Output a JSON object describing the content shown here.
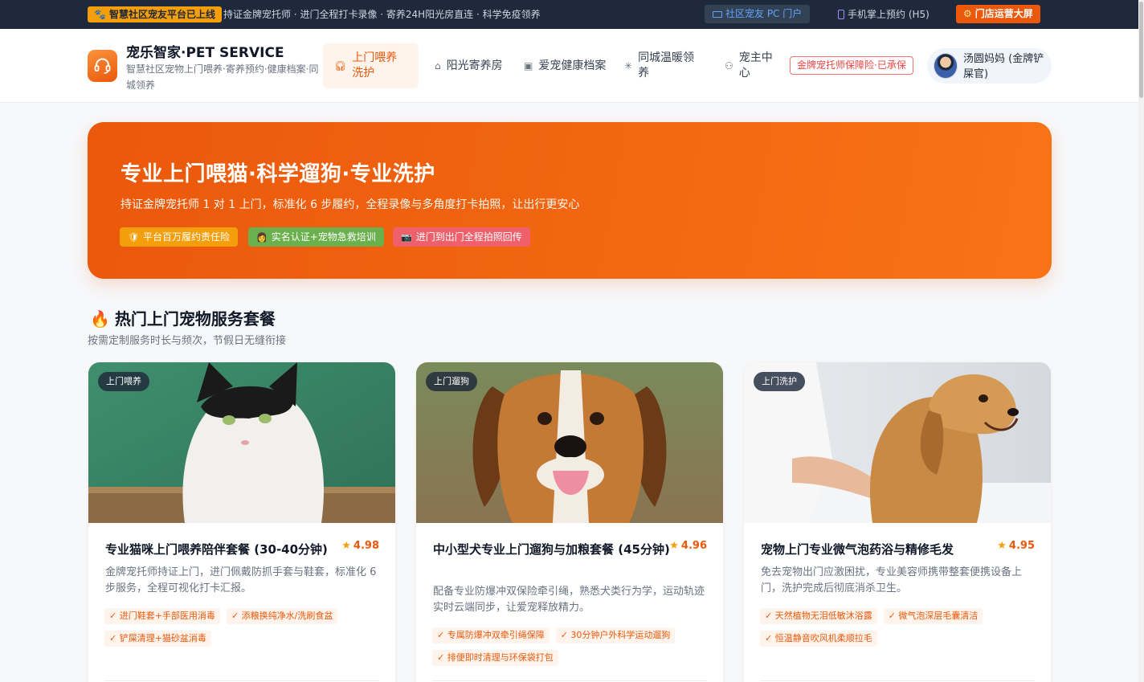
{
  "topbar": {
    "badge": "智慧社区宠友平台已上线",
    "ticker": "持证金牌宠托师 · 进门全程打卡录像 · 寄养24H阳光房直连 · 科学免疫领养",
    "pc_portal": "社区宠友 PC 门户",
    "h5": "手机掌上预约 (H5)",
    "store_screen": "门店运营大屏"
  },
  "header": {
    "brand_title": "宠乐智家·PET SERVICE",
    "brand_sub": "智慧社区宠物上门喂养·寄养预约·健康档案·同城领养",
    "nav": [
      {
        "label": "上门喂养洗护",
        "icon": "headset-icon"
      },
      {
        "label": "阳光寄养房",
        "icon": "home-icon"
      },
      {
        "label": "爱宠健康档案",
        "icon": "health-record-icon"
      },
      {
        "label": "同城温暖领养",
        "icon": "loading-icon"
      },
      {
        "label": "宠主中心",
        "icon": "user-icon"
      }
    ],
    "insurance_badge": "金牌宠托师保障险·已承保",
    "user_name": "汤圆妈妈 (金牌铲屎官)"
  },
  "hero": {
    "title": "专业上门喂猫·科学遛狗·专业洗护",
    "subtitle": "持证金牌宠托师 1 对 1 上门，标准化 6 步履约，全程录像与多角度打卡拍照，让出行更安心",
    "tags": [
      "平台百万履约责任险",
      "实名认证+宠物急救培训",
      "进门到出门全程拍照回传"
    ]
  },
  "section": {
    "title": "热门上门宠物服务套餐",
    "subtitle": "按需定制服务时长与频次，节假日无缝衔接"
  },
  "cards": [
    {
      "label": "上门喂养",
      "title": "专业猫咪上门喂养陪伴套餐 (30-40分钟)",
      "rating": "4.98",
      "desc": "金牌宠托师持证上门，进门佩戴防抓手套与鞋套，标准化 6 步服务，全程可视化打卡汇报。",
      "chips": [
        "✓ 进门鞋套+手部医用消毒",
        "✓ 添粮换纯净水/洗刷食盆",
        "✓ 铲屎清理+猫砂盆消毒"
      ],
      "image": "cat-photo"
    },
    {
      "label": "上门遛狗",
      "title": "中小型犬专业上门遛狗与加粮套餐 (45分钟)",
      "rating": "4.96",
      "desc": "配备专业防爆冲双保险牵引绳，熟悉犬类行为学，运动轨迹实时云端同步，让爱宠释放精力。",
      "chips": [
        "✓ 专属防爆冲双牵引绳保障",
        "✓ 30分钟户外科学运动遛狗",
        "✓ 排便即时清理与环保袋打包"
      ],
      "image": "beagle-photo"
    },
    {
      "label": "上门洗护",
      "title": "宠物上门专业微气泡药浴与精修毛发",
      "rating": "4.95",
      "desc": "免去宠物出门应激困扰，专业美容师携带整套便携设备上门，洗护完成后彻底消杀卫生。",
      "chips": [
        "✓ 天然植物无泪低敏沐浴露",
        "✓ 微气泡深层毛囊清洁",
        "✓ 恒温静音吹风机柔顺拉毛"
      ],
      "image": "golden-retriever-photo"
    }
  ],
  "colors": {
    "accent": "#ea580c",
    "topbar_bg": "#1e293b",
    "badge_yellow": "#f59e0b",
    "insurance_red": "#ef4444"
  }
}
